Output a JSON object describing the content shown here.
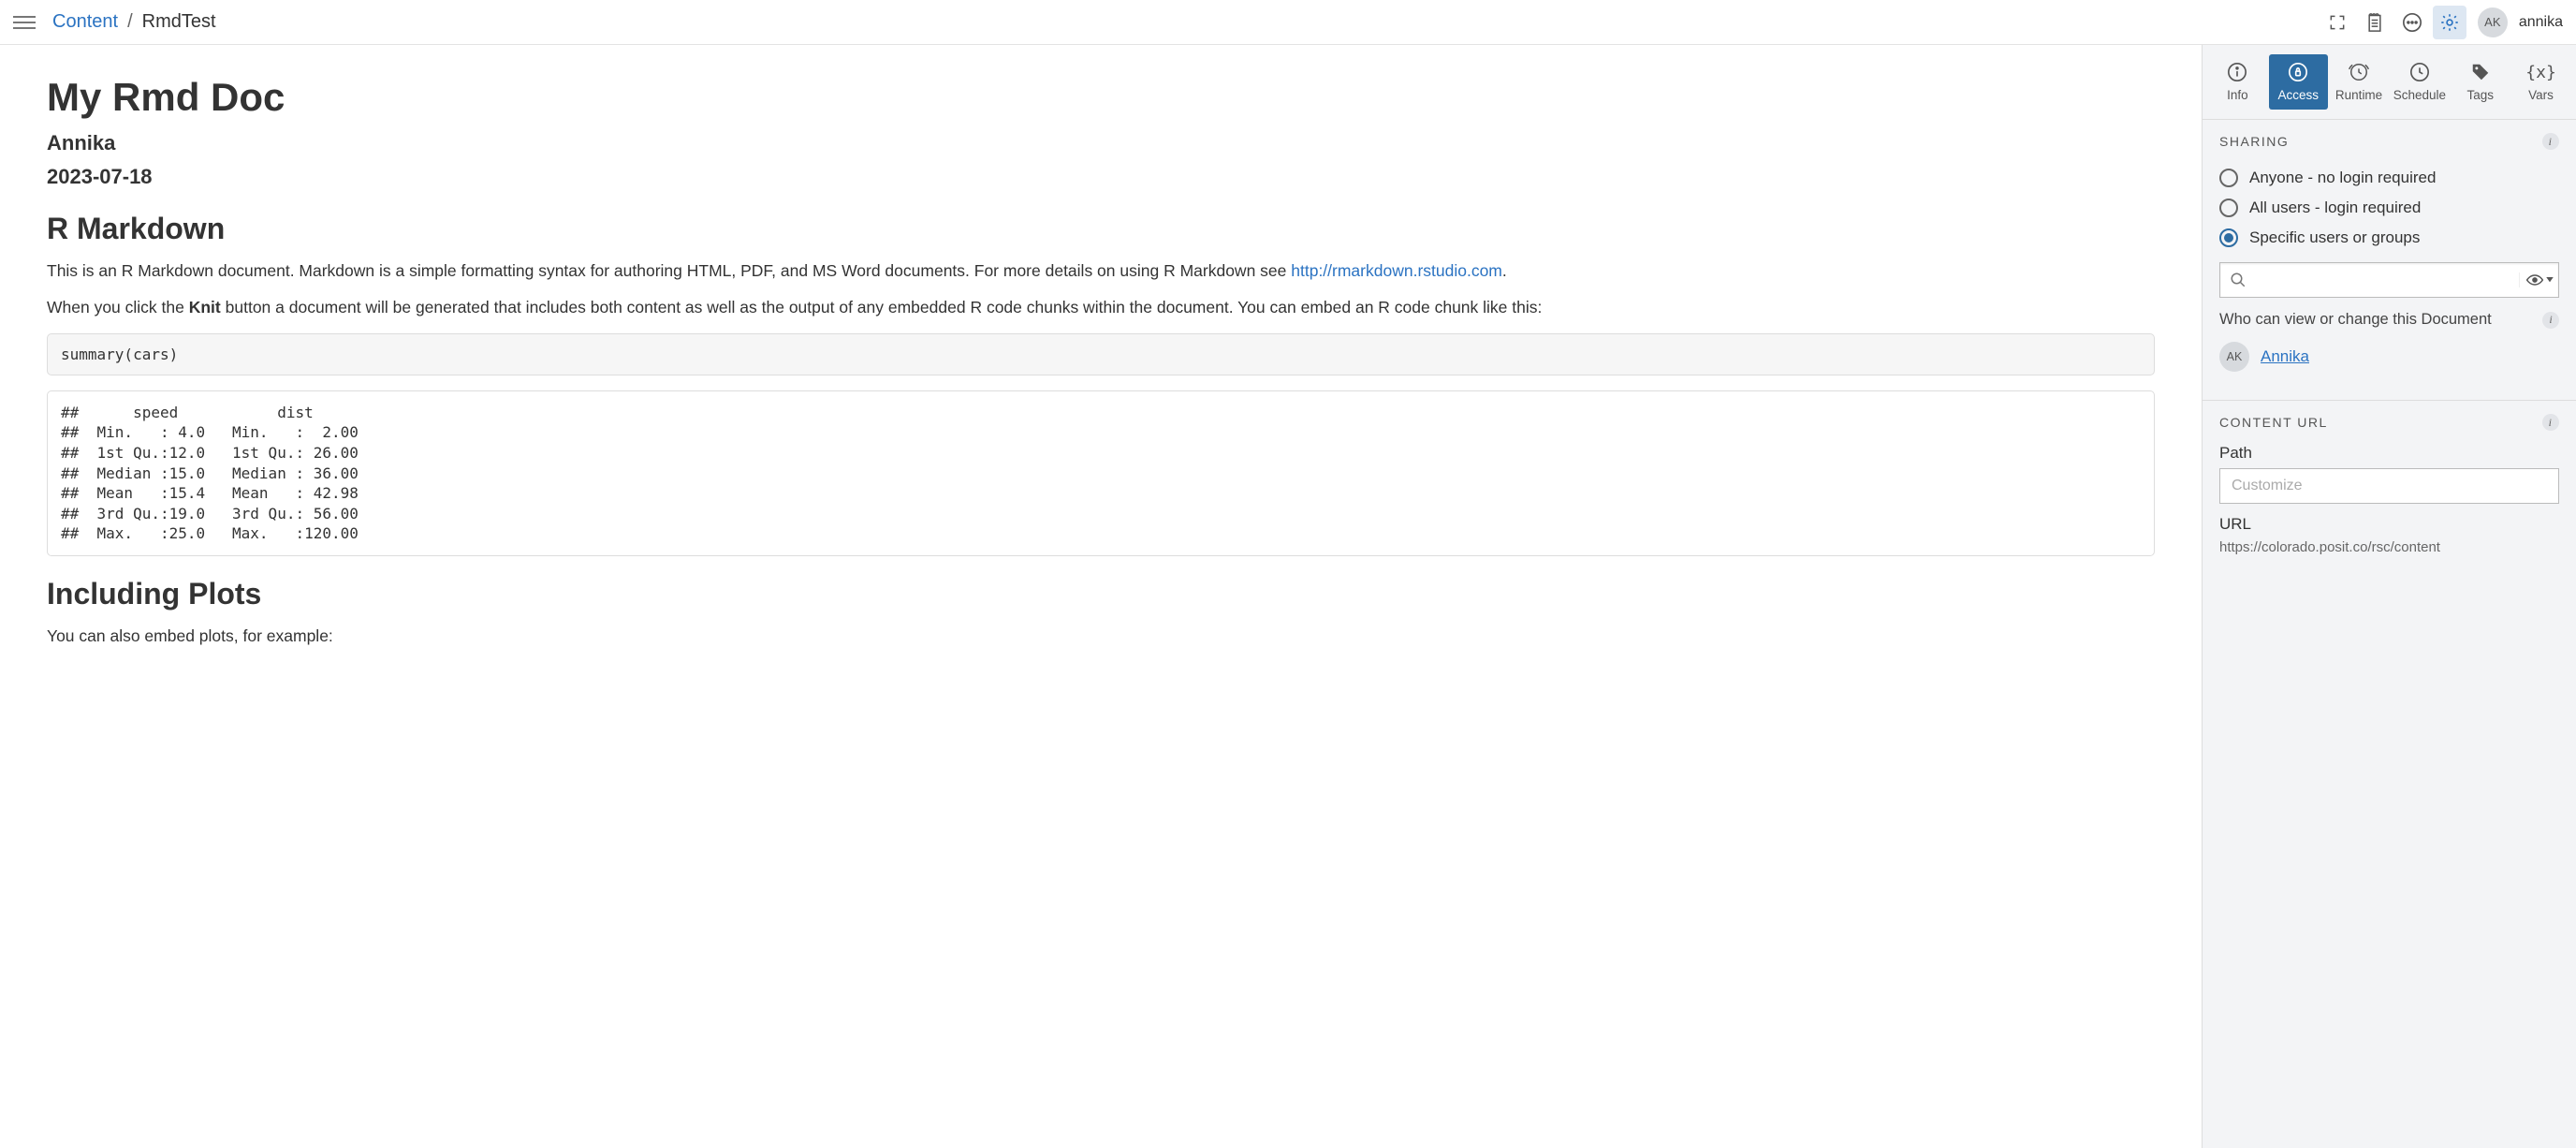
{
  "breadcrumb": {
    "root": "Content",
    "current": "RmdTest"
  },
  "topbar": {
    "username": "annika",
    "avatar_initials": "AK"
  },
  "document": {
    "title": "My Rmd Doc",
    "author": "Annika",
    "date": "2023-07-18",
    "section1_heading": "R Markdown",
    "p1_pre": "This is an R Markdown document. Markdown is a simple formatting syntax for authoring HTML, PDF, and MS Word documents. For more details on using R Markdown see ",
    "p1_link_text": "http://rmarkdown.rstudio.com",
    "p1_post": ".",
    "p2_pre": "When you click the ",
    "p2_bold": "Knit",
    "p2_post": " button a document will be generated that includes both content as well as the output of any embedded R code chunks within the document. You can embed an R code chunk like this:",
    "code1": "summary(cars)",
    "output1": "##      speed           dist       \n##  Min.   : 4.0   Min.   :  2.00  \n##  1st Qu.:12.0   1st Qu.: 26.00  \n##  Median :15.0   Median : 36.00  \n##  Mean   :15.4   Mean   : 42.98  \n##  3rd Qu.:19.0   3rd Qu.: 56.00  \n##  Max.   :25.0   Max.   :120.00",
    "section2_heading": "Including Plots",
    "p3": "You can also embed plots, for example:"
  },
  "panel_tabs": {
    "info": "Info",
    "access": "Access",
    "runtime": "Runtime",
    "schedule": "Schedule",
    "tags": "Tags",
    "vars": "Vars"
  },
  "sharing": {
    "heading": "SHARING",
    "options": {
      "anyone": "Anyone - no login required",
      "all_users": "All users - login required",
      "specific": "Specific users or groups"
    },
    "subheading": "Who can view or change this Document",
    "user_name": "Annika",
    "user_initials": "AK"
  },
  "content_url": {
    "heading": "CONTENT URL",
    "path_label": "Path",
    "path_placeholder": "Customize",
    "url_label": "URL",
    "url_value": "https://colorado.posit.co/rsc/content"
  }
}
